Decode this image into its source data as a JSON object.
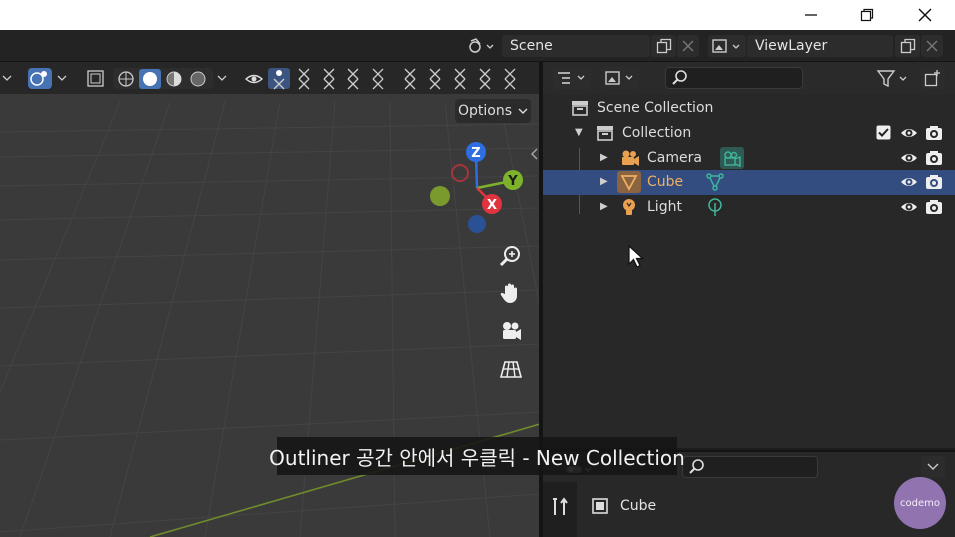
{
  "window": {
    "controls": [
      "minimize",
      "restore",
      "close"
    ]
  },
  "topbar": {
    "scene": "Scene",
    "view_layer": "ViewLayer"
  },
  "viewport": {
    "options_label": "Options",
    "gizmo": {
      "z": "Z",
      "y": "Y",
      "x": "X"
    },
    "colors": {
      "x_axis": "#e0343f",
      "y_axis": "#7cb32b",
      "z_axis": "#2f6ee0",
      "grid_bg": "#3a3a3a"
    }
  },
  "outliner": {
    "root": "Scene Collection",
    "collection": "Collection",
    "items": [
      {
        "name": "Camera",
        "selected": false,
        "icon": "camera-icon",
        "data_icon": "camera-data-icon"
      },
      {
        "name": "Cube",
        "selected": true,
        "icon": "mesh-object-icon",
        "data_icon": "mesh-data-icon"
      },
      {
        "name": "Light",
        "selected": false,
        "icon": "light-icon",
        "data_icon": "light-data-icon"
      }
    ],
    "colors": {
      "selected_row": "#334d80",
      "object_orange": "#e9a050",
      "data_green": "#3fb59a"
    }
  },
  "properties": {
    "object_name": "Cube"
  },
  "subtitle": "Outliner 공간 안에서 우클릭 - New Collection",
  "watermark": "codemo"
}
